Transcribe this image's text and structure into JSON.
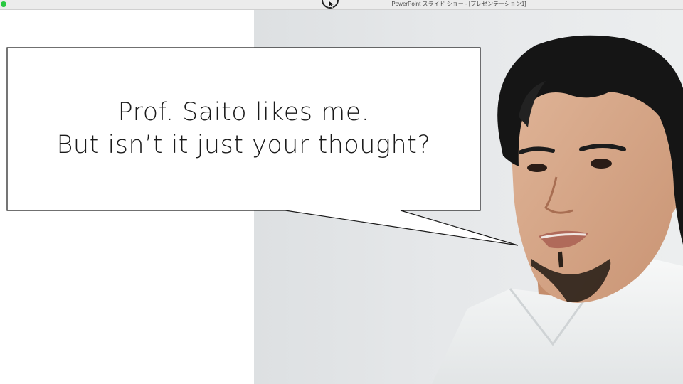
{
  "window": {
    "title": "PowerPoint スライド ショー - [プレゼンテーション1]"
  },
  "icons": {
    "close_button": "traffic-light-green",
    "cursor": "pointer-cursor-icon"
  },
  "slide": {
    "speech_bubble": {
      "line1": "Prof. Saito likes me.",
      "line2": "But isn’t it just your thought?"
    },
    "photo": {
      "subject": "man-portrait"
    }
  },
  "colors": {
    "traffic_green": "#28c840",
    "titlebar": "#ececec",
    "text": "#1a1a1a"
  }
}
